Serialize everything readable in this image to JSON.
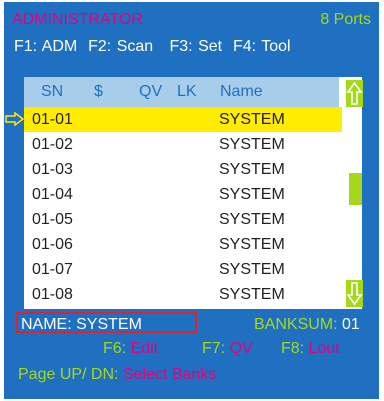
{
  "header": {
    "title": "ADMINISTRATOR",
    "ports": "8 Ports"
  },
  "fkeys": {
    "f1": "F1: ADM",
    "f2": "F2: Scan",
    "f3": "F3: Set",
    "f4": "F4: Tool"
  },
  "columns": {
    "sn": "SN",
    "dollar": "$",
    "qv": "QV",
    "lk": "LK",
    "name": "Name"
  },
  "rows": [
    {
      "sn": "01-01",
      "name": "SYSTEM"
    },
    {
      "sn": "01-02",
      "name": "SYSTEM"
    },
    {
      "sn": "01-03",
      "name": "SYSTEM"
    },
    {
      "sn": "01-04",
      "name": "SYSTEM"
    },
    {
      "sn": "01-05",
      "name": "SYSTEM"
    },
    {
      "sn": "01-06",
      "name": "SYSTEM"
    },
    {
      "sn": "01-07",
      "name": "SYSTEM"
    },
    {
      "sn": "01-08",
      "name": "SYSTEM"
    }
  ],
  "selected_row": 0,
  "footer": {
    "name": "NAME: SYSTEM",
    "banksum_label": "BANKSUM:",
    "banksum_value": "01",
    "f6_key": "F6:",
    "f6_value": "Edit",
    "f7_key": "F7:",
    "f7_value": "QV",
    "f8_key": "F8:",
    "f8_value": "Lout",
    "page_key": "Page UP/ DN:",
    "page_value": "Select Banks"
  },
  "icons": {
    "pointer": "arrow-right-outline-icon",
    "scroll_up": "arrow-up-icon",
    "scroll_down": "arrow-down-icon"
  },
  "colors": {
    "background": "#1f70c1",
    "accent_green": "#a5d81b",
    "accent_magenta": "#e3007f",
    "selection": "#ffec00",
    "header_band": "#a8cdeb",
    "name_box_border": "#e0222f"
  }
}
